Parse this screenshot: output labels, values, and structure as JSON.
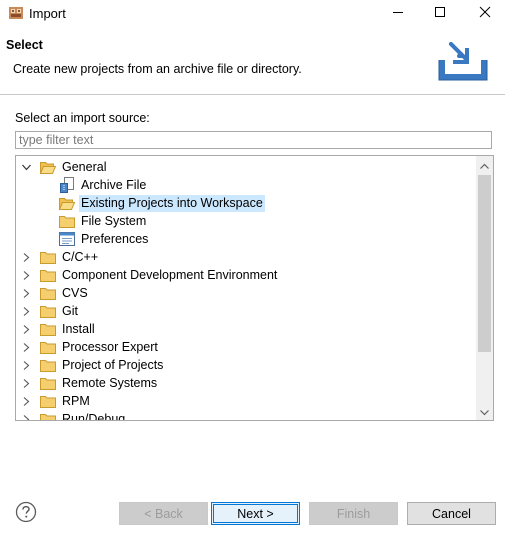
{
  "window": {
    "title": "Import",
    "minimize_icon": "minimize-icon",
    "maximize_icon": "maximize-icon",
    "close_icon": "close-icon"
  },
  "banner": {
    "title": "Select",
    "description": "Create new projects from an archive file or directory.",
    "icon": "import-wizard-icon"
  },
  "source": {
    "label": "Select an import source:",
    "filter_placeholder": "type filter text",
    "filter_value": ""
  },
  "tree": {
    "items": [
      {
        "label": "General",
        "expanded": true,
        "level": 0,
        "icon": "folder-open-icon"
      },
      {
        "label": "Archive File",
        "level": 1,
        "icon": "archive-file-icon"
      },
      {
        "label": "Existing Projects into Workspace",
        "level": 1,
        "icon": "folder-open-icon",
        "selected": true
      },
      {
        "label": "File System",
        "level": 1,
        "icon": "folder-icon"
      },
      {
        "label": "Preferences",
        "level": 1,
        "icon": "preferences-icon"
      },
      {
        "label": "C/C++",
        "expanded": false,
        "level": 0,
        "icon": "folder-icon"
      },
      {
        "label": "Component Development Environment",
        "expanded": false,
        "level": 0,
        "icon": "folder-icon"
      },
      {
        "label": "CVS",
        "expanded": false,
        "level": 0,
        "icon": "folder-icon"
      },
      {
        "label": "Git",
        "expanded": false,
        "level": 0,
        "icon": "folder-icon"
      },
      {
        "label": "Install",
        "expanded": false,
        "level": 0,
        "icon": "folder-icon"
      },
      {
        "label": "Processor Expert",
        "expanded": false,
        "level": 0,
        "icon": "folder-icon"
      },
      {
        "label": "Project of Projects",
        "expanded": false,
        "level": 0,
        "icon": "folder-icon"
      },
      {
        "label": "Remote Systems",
        "expanded": false,
        "level": 0,
        "icon": "folder-icon"
      },
      {
        "label": "RPM",
        "expanded": false,
        "level": 0,
        "icon": "folder-icon"
      },
      {
        "label": "Run/Debug",
        "expanded": false,
        "level": 0,
        "icon": "folder-icon"
      }
    ]
  },
  "footer": {
    "help_icon": "help-icon",
    "back_label": "< Back",
    "next_label": "Next >",
    "finish_label": "Finish",
    "cancel_label": "Cancel"
  },
  "colors": {
    "selection": "#cce8ff",
    "default_button_border": "#0078d7",
    "folder": "#e8b54a"
  }
}
